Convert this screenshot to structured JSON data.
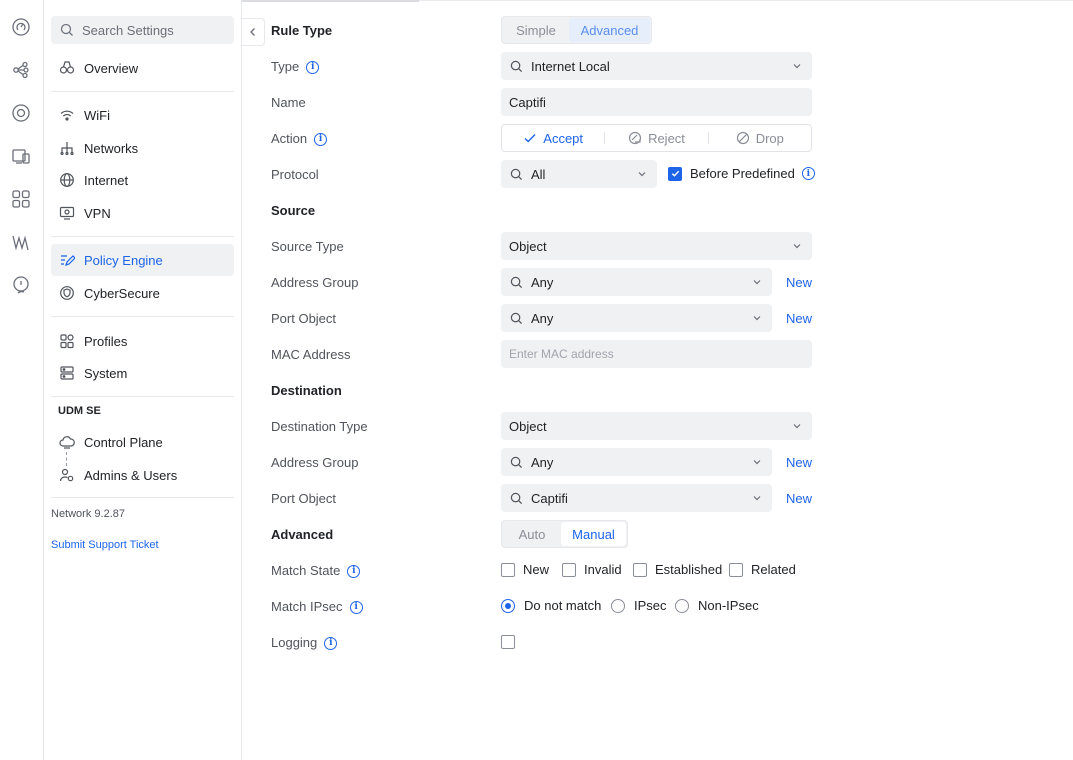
{
  "rail": [
    "dashboard-icon",
    "topology-icon",
    "devices-icon",
    "client-devices-icon",
    "apps-icon",
    "insights-icon",
    "support-icon"
  ],
  "sidebar": {
    "search_placeholder": "Search Settings",
    "items": [
      {
        "label": "Overview",
        "icon": "overview-icon"
      },
      {
        "label": "WiFi",
        "icon": "wifi-icon"
      },
      {
        "label": "Networks",
        "icon": "networks-icon"
      },
      {
        "label": "Internet",
        "icon": "globe-icon"
      },
      {
        "label": "VPN",
        "icon": "vpn-icon"
      },
      {
        "label": "Policy Engine",
        "icon": "policy-icon",
        "active": true
      },
      {
        "label": "CyberSecure",
        "icon": "shield-icon"
      },
      {
        "label": "Profiles",
        "icon": "profiles-icon"
      },
      {
        "label": "System",
        "icon": "system-icon"
      },
      {
        "label": "Control Plane",
        "icon": "cloud-icon"
      },
      {
        "label": "Admins & Users",
        "icon": "admins-icon"
      }
    ],
    "group_title": "UDM SE",
    "version": "Network 9.2.87",
    "support_link": "Submit Support Ticket"
  },
  "form": {
    "rule_type": {
      "label": "Rule Type",
      "options": [
        "Simple",
        "Advanced"
      ],
      "selected": "Advanced"
    },
    "type": {
      "label": "Type",
      "value": "Internet Local"
    },
    "name": {
      "label": "Name",
      "value": "Captifi"
    },
    "action": {
      "label": "Action",
      "options": [
        "Accept",
        "Reject",
        "Drop"
      ],
      "selected": "Accept"
    },
    "protocol": {
      "label": "Protocol",
      "value": "All",
      "before_predefined_label": "Before Predefined",
      "before_predefined": true
    },
    "source": {
      "section": "Source",
      "type_label": "Source Type",
      "type_value": "Object",
      "address_group_label": "Address Group",
      "address_group_value": "Any",
      "port_object_label": "Port Object",
      "port_object_value": "Any",
      "mac_label": "MAC Address",
      "mac_placeholder": "Enter MAC address"
    },
    "destination": {
      "section": "Destination",
      "type_label": "Destination Type",
      "type_value": "Object",
      "address_group_label": "Address Group",
      "address_group_value": "Any",
      "port_object_label": "Port Object",
      "port_object_value": "Captifi"
    },
    "new_label": "New",
    "advanced": {
      "section": "Advanced",
      "options": [
        "Auto",
        "Manual"
      ],
      "selected": "Manual"
    },
    "match_state": {
      "label": "Match State",
      "options": [
        "New",
        "Invalid",
        "Established",
        "Related"
      ]
    },
    "match_ipsec": {
      "label": "Match IPsec",
      "options": [
        "Do not match",
        "IPsec",
        "Non-IPsec"
      ],
      "selected": "Do not match"
    },
    "logging": {
      "label": "Logging",
      "checked": false
    }
  },
  "colors": {
    "accent": "#1d64e8",
    "field_bg": "#f0f1f3",
    "border": "#e7e8ec"
  }
}
